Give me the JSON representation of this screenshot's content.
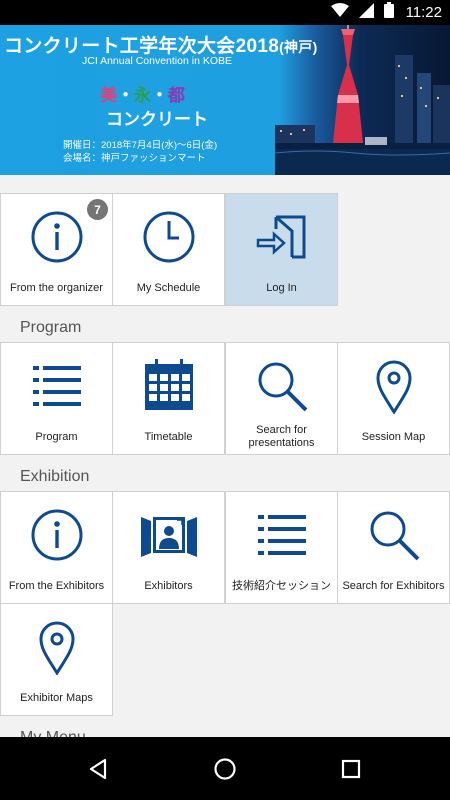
{
  "status_bar": {
    "time": "11:22",
    "icons": [
      "wifi-icon",
      "signal-icon",
      "battery-icon"
    ]
  },
  "banner": {
    "title": "コンクリート工学年次大会2018",
    "title_suffix": "(神戸)",
    "subtitle": "JCI Annual Convention in KOBE",
    "tagline_1": "美",
    "tagline_2": "永",
    "tagline_3": "都",
    "tagline_sep": "・",
    "tagline_word": "コンクリート",
    "date": "開催日：2018年7月4日(水)〜6日(金)",
    "venue": "会場名：神戸ファッションマート"
  },
  "top_tiles": [
    {
      "label": "From the organizer",
      "icon": "info-icon",
      "badge": "7"
    },
    {
      "label": "My Schedule",
      "icon": "clock-icon"
    },
    {
      "label": "Log In",
      "icon": "login-icon"
    }
  ],
  "sections": {
    "program": {
      "title": "Program",
      "tiles": [
        {
          "label": "Program",
          "icon": "list-icon"
        },
        {
          "label": "Timetable",
          "icon": "calendar-icon"
        },
        {
          "label": "Search for presentations",
          "icon": "search-icon"
        },
        {
          "label": "Session Map",
          "icon": "map-pin-icon"
        }
      ]
    },
    "exhibition": {
      "title": "Exhibition",
      "tiles": [
        {
          "label": "From the Exhibitors",
          "icon": "info-icon"
        },
        {
          "label": "Exhibitors",
          "icon": "exhibitor-booth-icon"
        },
        {
          "label": "技術紹介セッション",
          "icon": "list-icon"
        },
        {
          "label": "Search for Exhibitors",
          "icon": "search-icon"
        },
        {
          "label": "Exhibitor Maps",
          "icon": "map-pin-icon"
        }
      ]
    },
    "my_menu": {
      "title": "My Menu"
    }
  },
  "nav_bar": {
    "buttons": [
      "back-icon",
      "home-icon",
      "recents-icon"
    ]
  },
  "colors": {
    "icon": "#0d4a8f",
    "banner": "#1e9fe0",
    "active_tile": "#c9dceb"
  }
}
